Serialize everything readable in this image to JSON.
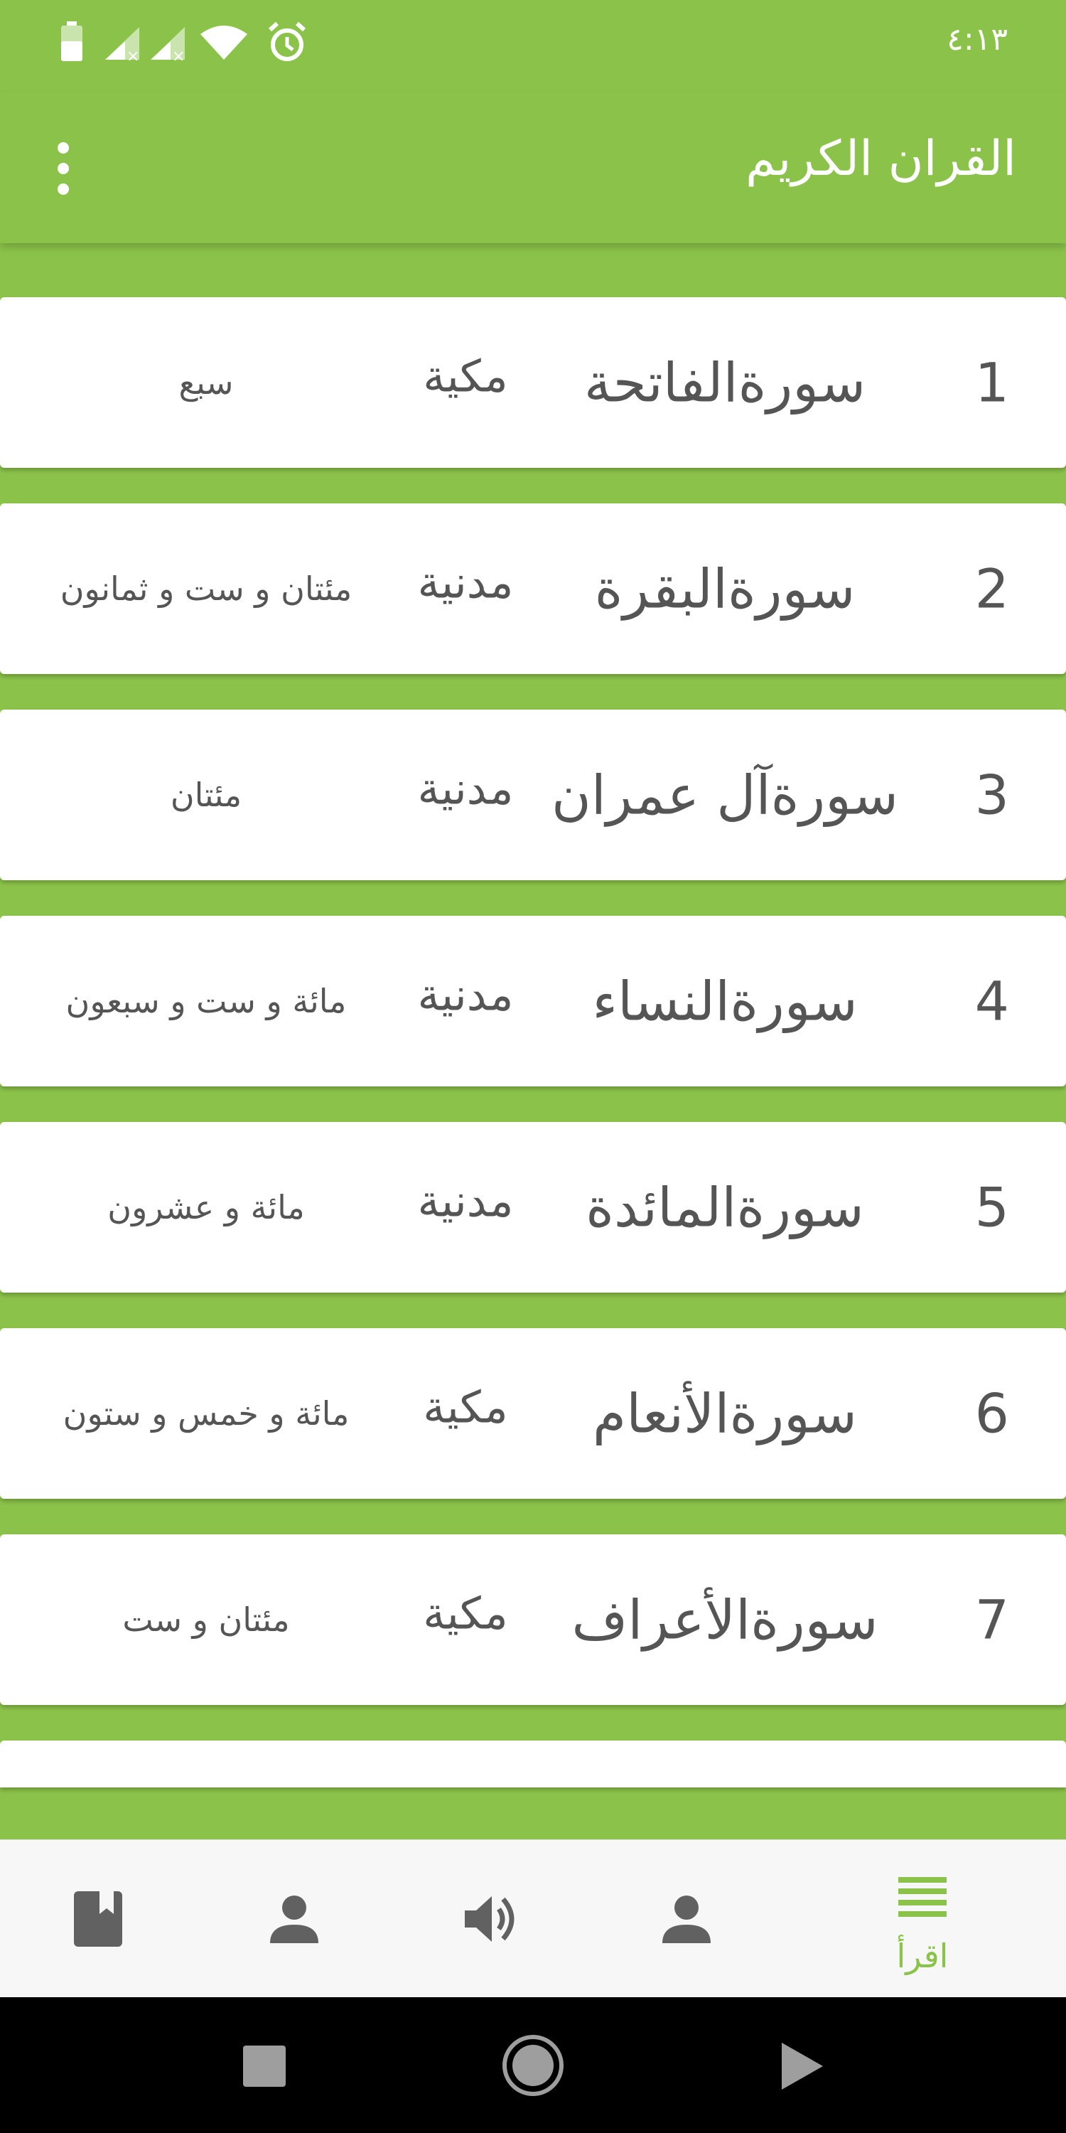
{
  "status_bar": {
    "time": "٤:١٣",
    "icons": [
      "battery-icon",
      "signal-off-icon",
      "signal-off-icon",
      "wifi-icon",
      "alarm-icon"
    ]
  },
  "app_bar": {
    "title": "القران الكريم",
    "menu_icon": "overflow-menu-icon"
  },
  "surahs": [
    {
      "number": "1",
      "name": "سورةالفاتحة",
      "type": "مكية",
      "ayahs": "سبع"
    },
    {
      "number": "2",
      "name": "سورةالبقرة",
      "type": "مدنية",
      "ayahs": "مئتان و ست و ثمانون"
    },
    {
      "number": "3",
      "name": "سورةآل عمران",
      "type": "مدنية",
      "ayahs": "مئتان"
    },
    {
      "number": "4",
      "name": "سورةالنساء",
      "type": "مدنية",
      "ayahs": "مائة و ست و سبعون"
    },
    {
      "number": "5",
      "name": "سورةالمائدة",
      "type": "مدنية",
      "ayahs": "مائة و عشرون"
    },
    {
      "number": "6",
      "name": "سورةالأنعام",
      "type": "مكية",
      "ayahs": "مائة و خمس و ستون"
    },
    {
      "number": "7",
      "name": "سورةالأعراف",
      "type": "مكية",
      "ayahs": "مئتان و ست"
    }
  ],
  "bottom_nav": {
    "items": [
      {
        "icon": "bookmark-book-icon",
        "label": ""
      },
      {
        "icon": "person-icon",
        "label": ""
      },
      {
        "icon": "volume-icon",
        "label": ""
      },
      {
        "icon": "person-icon",
        "label": ""
      },
      {
        "icon": "list-icon",
        "label": "اقرأ"
      }
    ],
    "active_color": "#8BC34A",
    "inactive_color": "#616161"
  },
  "colors": {
    "primary": "#8BC34A",
    "card": "#FFFFFF",
    "text": "#555555"
  }
}
